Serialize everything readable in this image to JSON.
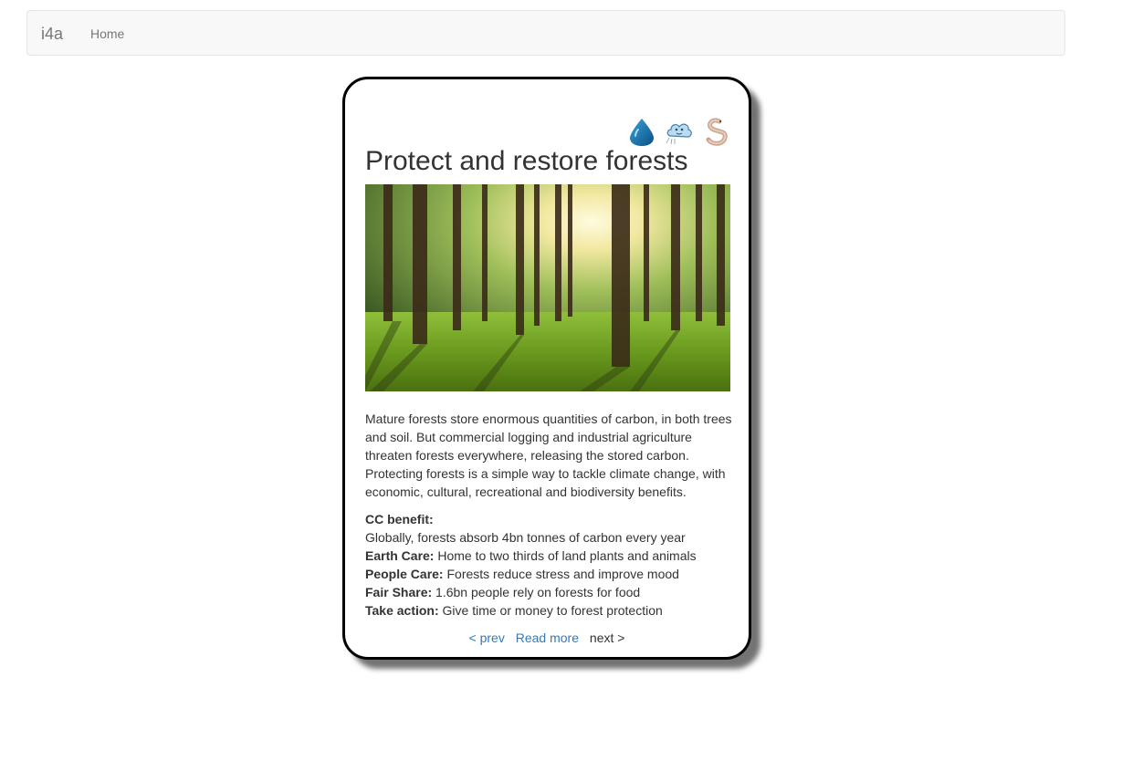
{
  "navbar": {
    "brand": "i4a",
    "home": "Home"
  },
  "card": {
    "icons": [
      "water-drop-icon",
      "air-cloud-icon",
      "worm-icon"
    ],
    "title": "Protect and restore forests",
    "image": "forest-photo",
    "description": "Mature forests store enormous quantities of carbon, in both trees and soil. But commercial logging and industrial agriculture threaten forests everywhere, releasing the stored carbon. Protecting forests is a simple way to tackle climate change, with economic, cultural, recreational and biodiversity benefits.",
    "cc_benefit_label": "CC benefit:",
    "cc_benefit": "Globally, forests absorb 4bn tonnes of carbon every year",
    "earth_care_label": "Earth Care:",
    "earth_care": "Home to two thirds of land plants and animals",
    "people_care_label": "People Care:",
    "people_care": "Forests reduce stress and improve mood",
    "fair_share_label": "Fair Share:",
    "fair_share": "1.6bn people rely on forests for food",
    "take_action_label": "Take action:",
    "take_action": "Give time or money to forest protection",
    "nav": {
      "prev": "< prev",
      "read_more": "Read more",
      "next": "next >"
    }
  },
  "colors": {
    "link": "#337ab7",
    "navbar_bg": "#f8f8f8",
    "text": "#333333"
  }
}
